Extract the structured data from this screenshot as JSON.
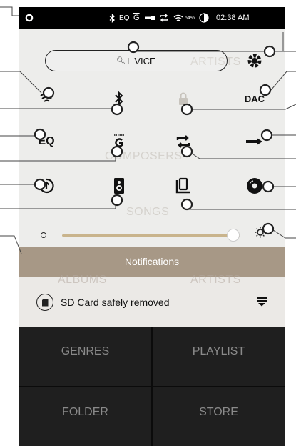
{
  "status_bar": {
    "battery_percent": "54%",
    "time": "02:38 AM",
    "eq_label": "EQ",
    "gain_label": "G"
  },
  "quick_panel": {
    "search_label": "L  VICE",
    "eq_label": "EQ",
    "dac_label": "DAC",
    "background_labels": [
      "ARTISTS",
      "COMPOSERS",
      "SONGS"
    ]
  },
  "notifications": {
    "header": "Notifications",
    "message": "SD Card safely removed",
    "background_labels": [
      "ALBUMS",
      "ARTISTS"
    ]
  },
  "library": {
    "tiles": [
      "GENRES",
      "PLAYLIST",
      "FOLDER",
      "STORE"
    ]
  },
  "volume": {
    "level_fraction": 0.96
  }
}
